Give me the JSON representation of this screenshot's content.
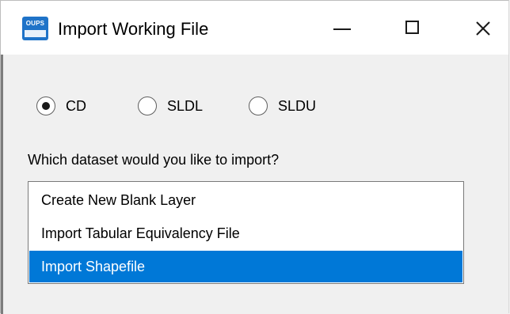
{
  "window": {
    "title": "Import Working File",
    "icon": "oups-app-icon",
    "icon_text": "OUPS",
    "controls": {
      "minimize": "minimize-icon",
      "maximize": "maximize-icon",
      "close": "close-icon"
    }
  },
  "radio_options": [
    {
      "label": "CD",
      "checked": true
    },
    {
      "label": "SLDL",
      "checked": false
    },
    {
      "label": "SLDU",
      "checked": false
    }
  ],
  "question": "Which dataset would you like to import?",
  "dataset_list": {
    "items": [
      {
        "label": "Create New Blank Layer",
        "selected": false
      },
      {
        "label": "Import Tabular Equivalency File",
        "selected": false
      },
      {
        "label": "Import Shapefile",
        "selected": true
      }
    ]
  },
  "colors": {
    "selection": "#0078d7",
    "titlebar": "#ffffff",
    "background": "#f0f0f0",
    "icon_blue": "#1f73c8"
  }
}
